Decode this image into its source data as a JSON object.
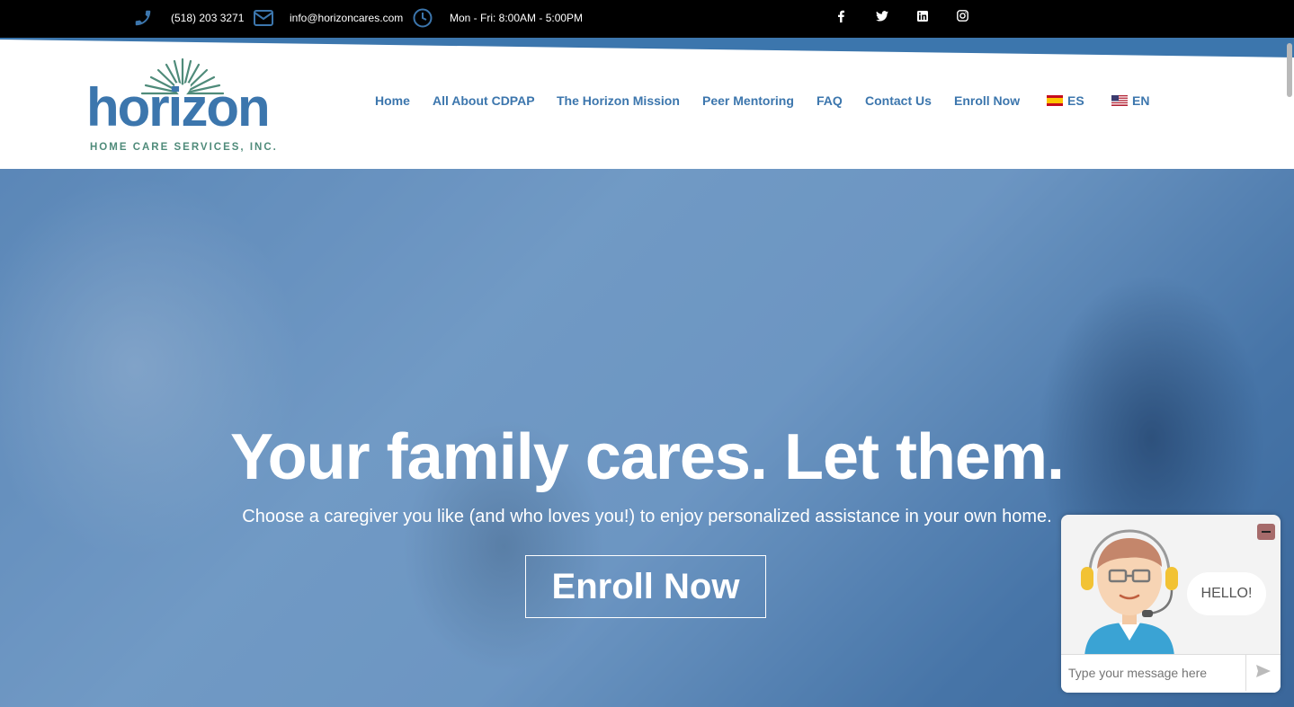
{
  "topbar": {
    "phone": "(518) 203 3271",
    "email": "info@horizoncares.com",
    "hours": "Mon - Fri: 8:00AM - 5:00PM",
    "socials": [
      "facebook-icon",
      "twitter-icon",
      "linkedin-icon",
      "instagram-icon"
    ]
  },
  "logo": {
    "word": "horizon",
    "subtitle": "HOME CARE SERVICES, INC."
  },
  "nav": {
    "items": [
      "Home",
      "All About CDPAP",
      "The Horizon Mission",
      "Peer Mentoring",
      "FAQ",
      "Contact Us",
      "Enroll Now"
    ],
    "lang_es": "ES",
    "lang_en": "EN"
  },
  "hero": {
    "title": "Your family cares. Let them.",
    "subtitle": "Choose a caregiver you like (and who loves you!) to enjoy personalized assistance in your own home.",
    "button": "Enroll Now"
  },
  "chat": {
    "greeting": "HELLO!",
    "placeholder": "Type your message here"
  },
  "colors": {
    "brand_blue": "#3c76ad",
    "brand_green": "#4f8b7a",
    "topbar": "#000000"
  }
}
